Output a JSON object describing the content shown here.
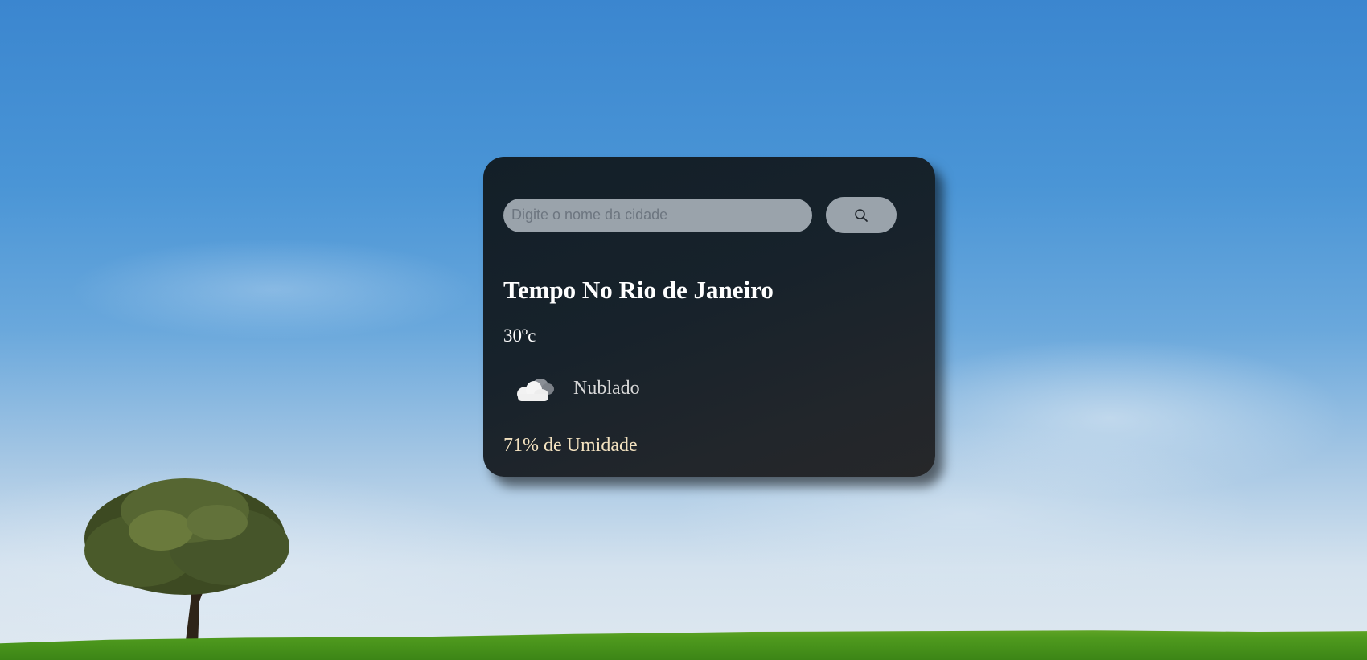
{
  "search": {
    "placeholder": "Digite o nome da cidade",
    "value": ""
  },
  "search_button": {
    "icon": "search-icon"
  },
  "weather": {
    "title": "Tempo No Rio de Janeiro",
    "temperature": "30ºc",
    "condition_icon": "cloud-icon",
    "condition": "Nublado",
    "humidity": "71% de Umidade"
  },
  "colors": {
    "card_bg": "#17222b",
    "input_bg": "#9aa3ab",
    "humidity_text": "#f3e2c0",
    "condition_text": "#d8d8d8"
  }
}
